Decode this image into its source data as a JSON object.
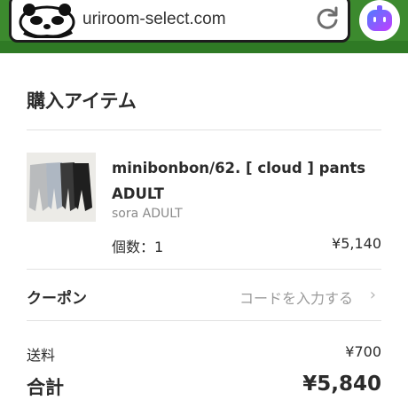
{
  "browser": {
    "url": "uriroom-select.com",
    "logo_icon": "panda-logo-icon",
    "reload_icon": "reload-icon",
    "assistant_icon": "robot-assistant-icon",
    "bar_color": "#3c8a2e"
  },
  "purchase": {
    "title": "購入アイテム",
    "item": {
      "name": "minibonbon/62. [ cloud ] pants ADULT",
      "variant": "sora ADULT",
      "quantity_label": "個数：1",
      "price": "¥5,140"
    }
  },
  "coupon": {
    "label": "クーポン",
    "placeholder": "コードを入力する",
    "chevron": "›"
  },
  "summary": {
    "shipping_label": "送料",
    "shipping_value": "¥700",
    "total_label": "合計",
    "total_value": "¥5,840"
  }
}
